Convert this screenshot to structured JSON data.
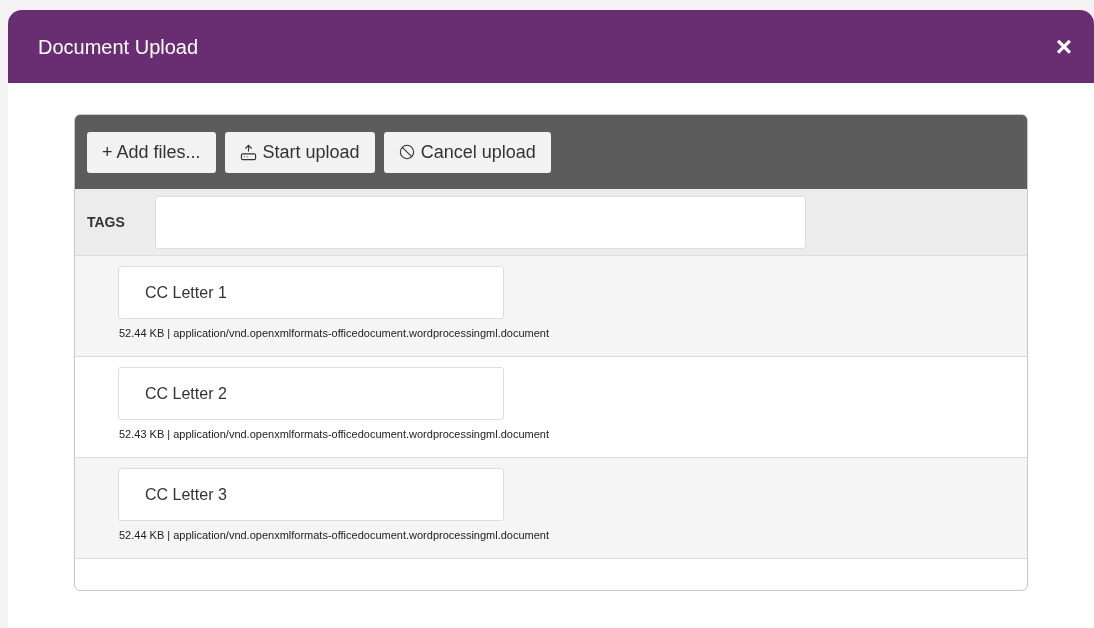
{
  "dialog": {
    "title": "Document Upload",
    "close": "×"
  },
  "toolbar": {
    "buttons": [
      {
        "kind": "add",
        "label": "+ Add files..."
      },
      {
        "kind": "start",
        "label": "Start upload"
      },
      {
        "kind": "cancel",
        "label": "Cancel upload"
      }
    ]
  },
  "tags": {
    "label": "TAGS"
  },
  "files": [
    {
      "name": "CC Letter 1",
      "info": "52.44 KB | application/vnd.openxmlformats-officedocument.wordprocessingml.document"
    },
    {
      "name": "CC Letter 2",
      "info": "52.43 KB | application/vnd.openxmlformats-officedocument.wordprocessingml.document"
    },
    {
      "name": "CC Letter 3",
      "info": "52.44 KB | application/vnd.openxmlformats-officedocument.wordprocessingml.document"
    }
  ]
}
